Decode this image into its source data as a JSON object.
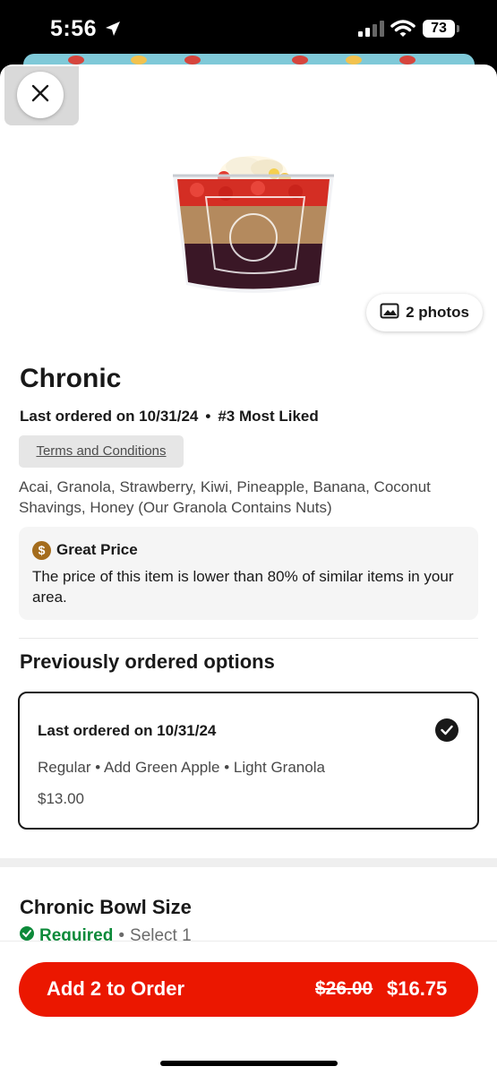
{
  "status_bar": {
    "time": "5:56",
    "battery": "73"
  },
  "item": {
    "title": "Chronic",
    "last_ordered": "Last ordered on 10/31/24",
    "rank": "#3 Most Liked",
    "terms_label": "Terms and Conditions",
    "description": "Acai, Granola, Strawberry, Kiwi, Pineapple, Banana, Coconut Shavings, Honey (Our Granola Contains Nuts)",
    "photos_label": "2 photos"
  },
  "great_price": {
    "title": "Great Price",
    "text": "The price of this item is lower than 80% of similar items in your area."
  },
  "previous": {
    "heading": "Previously ordered options",
    "card_title": "Last ordered on 10/31/24",
    "details": "Regular • Add Green Apple • Light Granola",
    "price": "$13.00"
  },
  "bowl_size": {
    "heading": "Chronic Bowl Size",
    "required": "Required",
    "select": "Select 1"
  },
  "footer": {
    "button_label": "Add 2 to Order",
    "old_price": "$26.00",
    "new_price": "$16.75"
  },
  "colors": {
    "brand_red": "#eb1700",
    "required_green": "#0d8a3a",
    "price_coin": "#a46c1c"
  },
  "icons": [
    "location-arrow-icon",
    "signal-icon",
    "wifi-icon",
    "battery-icon",
    "close-icon",
    "photo-icon",
    "dollar-coin-icon",
    "checkmark-circle-icon",
    "check-circle-green-icon"
  ]
}
